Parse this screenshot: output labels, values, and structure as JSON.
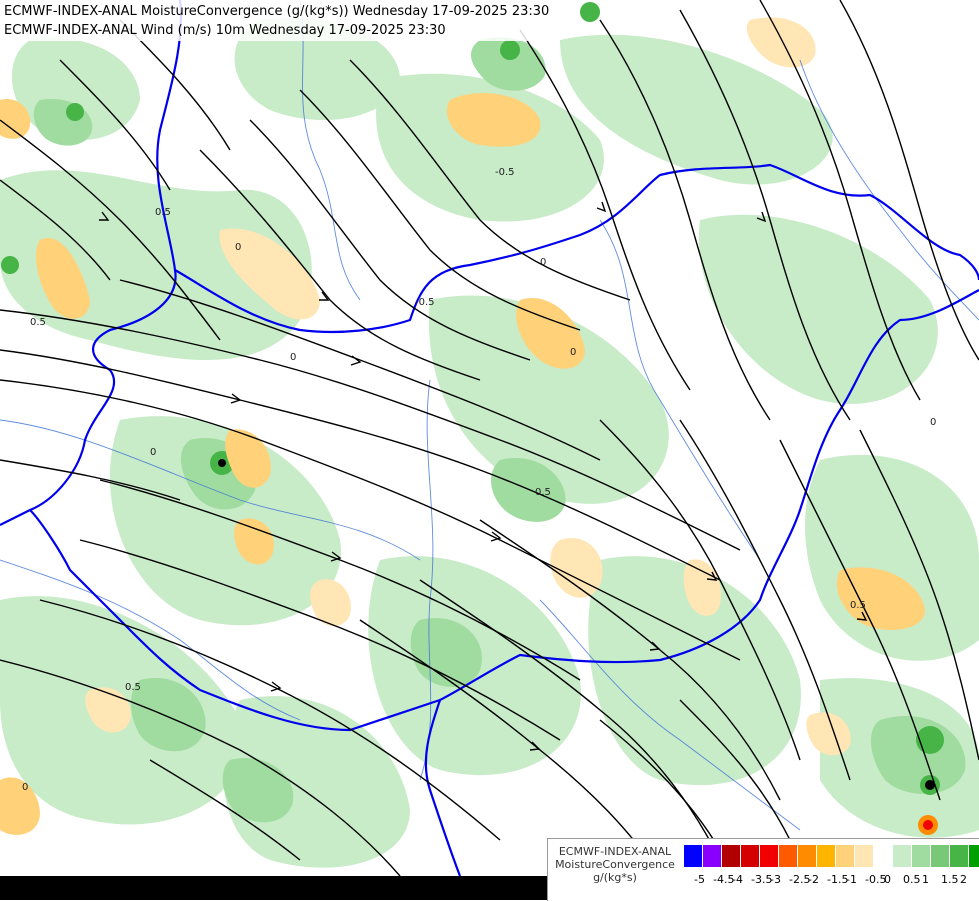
{
  "titles": {
    "line1": "ECMWF-INDEX-ANAL MoistureConvergence (g/(kg*s)) Wednesday 17-09-2025 23:30",
    "line2": "ECMWF-INDEX-ANAL Wind (m/s) 10m Wednesday 17-09-2025 23:30"
  },
  "legend": {
    "model": "ECMWF-INDEX-ANAL",
    "variable": "MoistureConvergence",
    "unit": "g/(kg*s)",
    "colors": [
      "#0000ff",
      "#8a00ff",
      "#b20000",
      "#d40000",
      "#f00000",
      "#ff5a00",
      "#ff8c00",
      "#ffb400",
      "#ffd27a",
      "#ffe6b4",
      "#ffffff",
      "#c8ebc8",
      "#a0dca0",
      "#78c878",
      "#46b446",
      "#00a000"
    ],
    "tick_labels": [
      "-5",
      "-4.5",
      "-4",
      "-3.5",
      "-3",
      "-2.5",
      "-2",
      "-1.5",
      "-1",
      "-0.5",
      "0",
      "0.5",
      "1",
      "1.5",
      "2"
    ]
  },
  "map": {
    "contour_labels": [
      "0.5",
      "0.5",
      "0",
      "0",
      "-0.5",
      "0.5",
      "0",
      "0",
      "0.5",
      "0",
      "0.5",
      "0",
      "0",
      "-0.5"
    ],
    "colors": {
      "border": "#0000ee",
      "river": "#3a6fd8",
      "streamline": "#000000",
      "dry": "#ffffff",
      "green_light": "#c8ebc8",
      "green_mid": "#a0dca0",
      "green_dark": "#46b446",
      "orange_light": "#ffe6b4",
      "orange_mid": "#ffd27a"
    }
  }
}
